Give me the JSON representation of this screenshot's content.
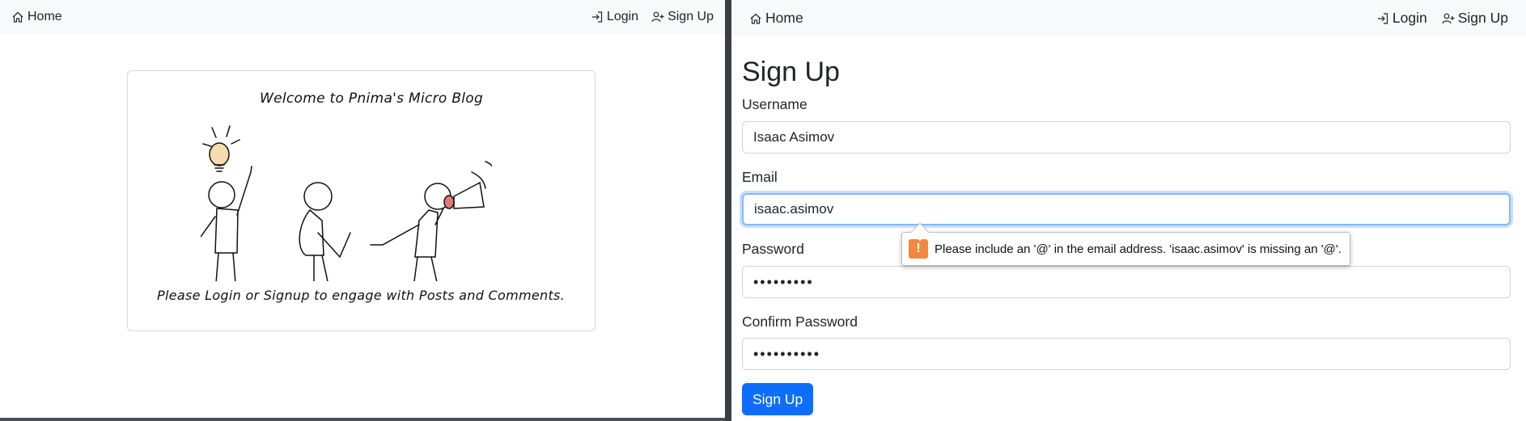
{
  "left_window": {
    "nav": {
      "home": "Home",
      "login": "Login",
      "signup": "Sign Up"
    },
    "welcome": {
      "title": "Welcome to Pnima's Micro Blog",
      "message": "Please Login or Signup to engage with Posts and Comments."
    }
  },
  "right_window": {
    "nav": {
      "home": "Home",
      "login": "Login",
      "signup": "Sign Up"
    },
    "form": {
      "title": "Sign Up",
      "username_label": "Username",
      "username_value": "Isaac Asimov",
      "email_label": "Email",
      "email_value": "isaac.asimov",
      "password_label": "Password",
      "password_value": "•••••••••",
      "confirm_label": "Confirm Password",
      "confirm_value": "••••••••••",
      "submit_label": "Sign Up"
    },
    "validation_tooltip": {
      "icon": "!",
      "message": "Please include an '@' in the email address. 'isaac.asimov' is missing an '@'."
    }
  },
  "colors": {
    "primary": "#0d6efd",
    "focus_ring": "#86b7fe",
    "navbar_bg": "#f8f9fa",
    "warning": "#f0883e"
  },
  "icons": {
    "home": "house-icon",
    "login": "login-arrow-icon",
    "signup": "person-plus-icon",
    "warning": "exclamation-icon"
  }
}
